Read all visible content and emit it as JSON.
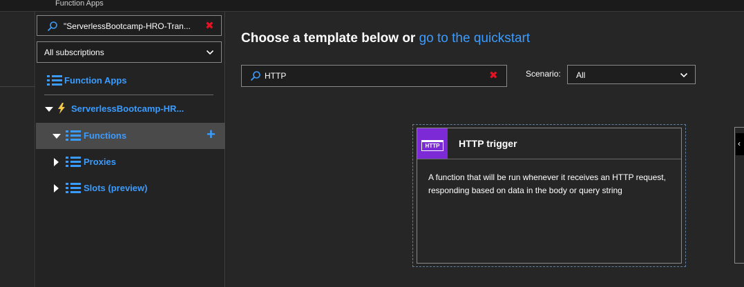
{
  "topbar": {
    "title": "Function Apps"
  },
  "sidebar": {
    "search": {
      "value": "\"ServerlessBootcamp-HRO-Tran..."
    },
    "subscription": {
      "value": "All subscriptions"
    },
    "items": [
      {
        "label": "Function Apps"
      },
      {
        "label": "ServerlessBootcamp-HR..."
      },
      {
        "label": "Functions"
      },
      {
        "label": "Proxies"
      },
      {
        "label": "Slots (preview)"
      }
    ]
  },
  "main": {
    "heading_text": "Choose a template below or",
    "heading_link": "go to the quickstart",
    "filter": {
      "value": "HTTP"
    },
    "scenario": {
      "label": "Scenario:",
      "value": "All"
    },
    "card": {
      "icon_text": "HTTP",
      "title": "HTTP trigger",
      "description": "A function that will be run whenever it receives an HTTP request, responding based on data in the body or query string"
    }
  },
  "colors": {
    "accent": "#3b9cff",
    "clear": "#e81123",
    "http_icon": "#7b2ad6"
  }
}
